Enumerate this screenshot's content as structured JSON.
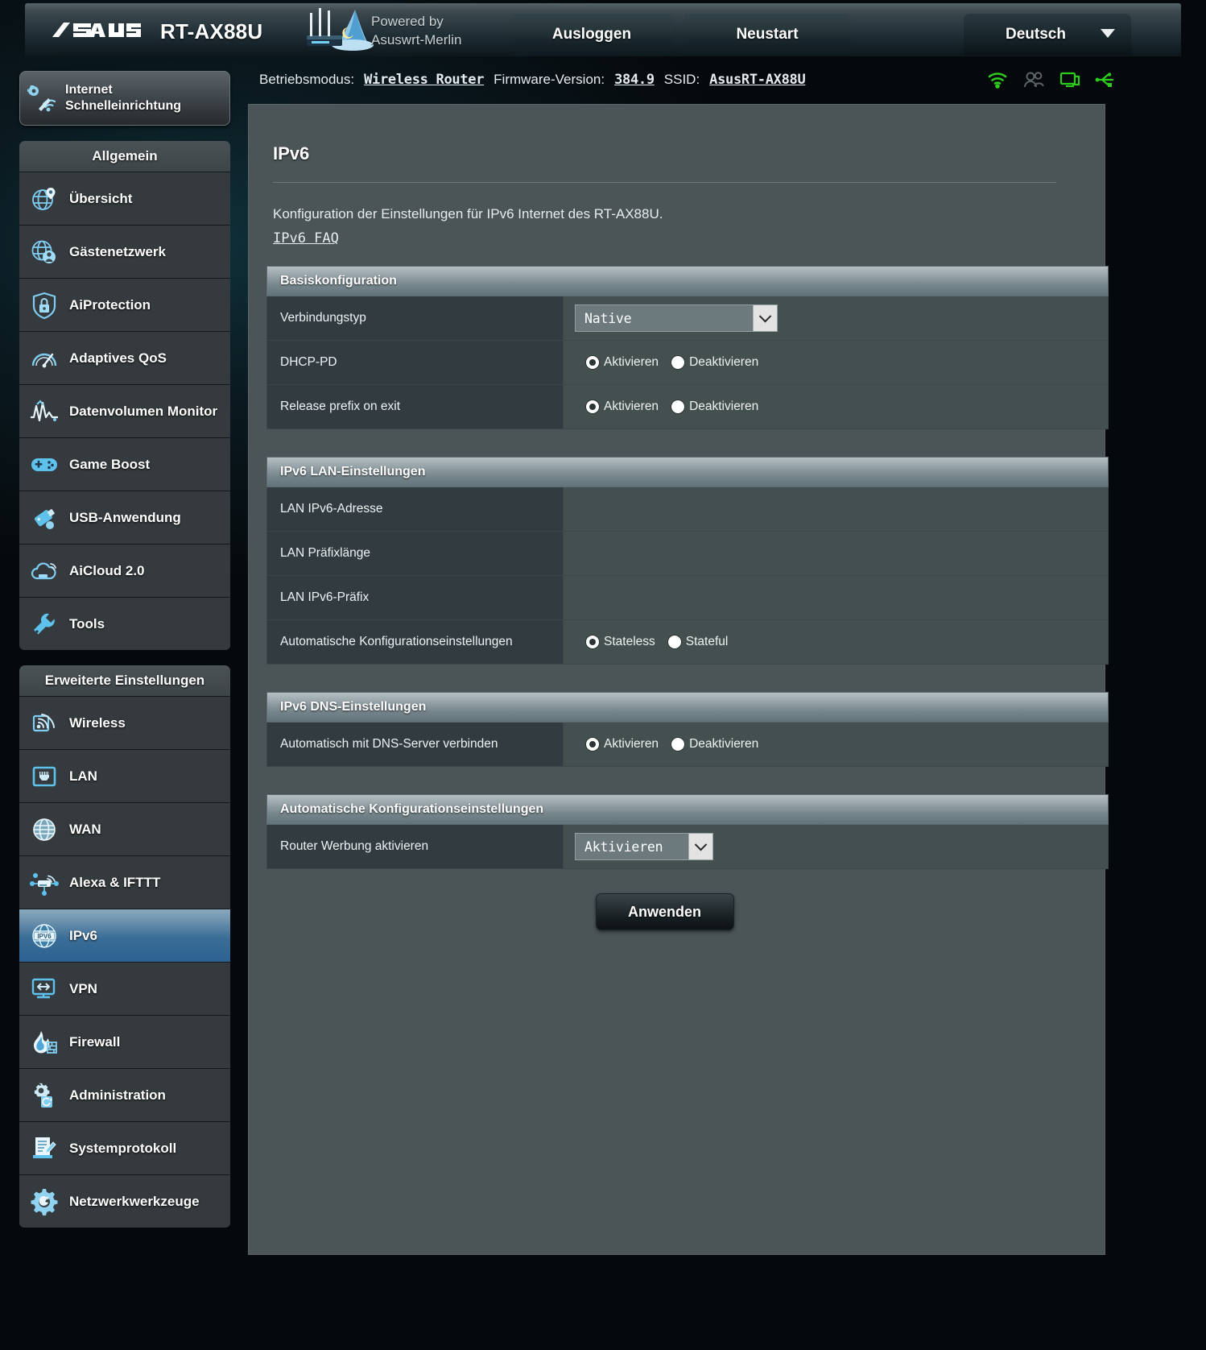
{
  "header": {
    "brand": "ASUS",
    "model": "RT-AX88U",
    "powered_by_line1": "Powered by",
    "powered_by_line2": "Asuswrt-Merlin",
    "logout_label": "Ausloggen",
    "reboot_label": "Neustart",
    "language_label": "Deutsch"
  },
  "status": {
    "mode_key": "Betriebsmodus:",
    "mode_value": "Wireless Router",
    "firmware_key": "Firmware-Version:",
    "firmware_value": "384.9",
    "ssid_key": "SSID:",
    "ssid_value": "AsusRT-AX88U",
    "icons": [
      "wifi-icon",
      "clients-icon",
      "monitor-icon",
      "usb-icon"
    ],
    "wifi_color": "#2ecc1e"
  },
  "sidebar": {
    "quick_setup": {
      "label_line1": "Internet",
      "label_line2": "Schnelleinrichtung",
      "icon": "quick-setup-icon"
    },
    "general_header": "Allgemein",
    "general_items": [
      {
        "label": "Übersicht",
        "icon": "network-map-icon"
      },
      {
        "label": "Gästenetzwerk",
        "icon": "guest-network-icon"
      },
      {
        "label": "AiProtection",
        "icon": "shield-lock-icon"
      },
      {
        "label": "Adaptives QoS",
        "icon": "gauge-icon"
      },
      {
        "label": "Datenvolumen Monitor",
        "icon": "traffic-monitor-icon"
      },
      {
        "label": "Game Boost",
        "icon": "gamepad-icon"
      },
      {
        "label": "USB-Anwendung",
        "icon": "usb-stick-icon"
      },
      {
        "label": "AiCloud 2.0",
        "icon": "cloud-icon"
      },
      {
        "label": "Tools",
        "icon": "wrench-icon"
      }
    ],
    "advanced_header": "Erweiterte Einstellungen",
    "advanced_items": [
      {
        "label": "Wireless",
        "icon": "wireless-icon",
        "active": false
      },
      {
        "label": "LAN",
        "icon": "lan-port-icon",
        "active": false
      },
      {
        "label": "WAN",
        "icon": "globe-icon",
        "active": false
      },
      {
        "label": "Alexa & IFTTT",
        "icon": "alexa-ifttt-icon",
        "active": false
      },
      {
        "label": "IPv6",
        "icon": "ipv6-globe-icon",
        "active": true
      },
      {
        "label": "VPN",
        "icon": "vpn-monitor-icon",
        "active": false
      },
      {
        "label": "Firewall",
        "icon": "firewall-flame-icon",
        "active": false
      },
      {
        "label": "Administration",
        "icon": "administration-gear-icon",
        "active": false
      },
      {
        "label": "Systemprotokoll",
        "icon": "system-log-icon",
        "active": false
      },
      {
        "label": "Netzwerkwerkzeuge",
        "icon": "network-tools-icon",
        "active": false
      }
    ]
  },
  "main": {
    "title": "IPv6",
    "description": "Konfiguration der Einstellungen für IPv6 Internet des RT-AX88U.",
    "faq_link": "IPv6 FAQ",
    "apply_label": "Anwenden",
    "sections": {
      "basic": {
        "header": "Basiskonfiguration",
        "connection_type_label": "Verbindungstyp",
        "connection_type_value": "Native",
        "dhcp_pd_label": "DHCP-PD",
        "dhcp_pd_enable": "Aktivieren",
        "dhcp_pd_disable": "Deaktivieren",
        "dhcp_pd_selected": "Aktivieren",
        "release_prefix_label": "Release prefix on exit",
        "release_prefix_enable": "Aktivieren",
        "release_prefix_disable": "Deaktivieren",
        "release_prefix_selected": "Aktivieren"
      },
      "lan": {
        "header": "IPv6 LAN-Einstellungen",
        "lan_address_label": "LAN IPv6-Adresse",
        "lan_address_value": "",
        "lan_prefix_length_label": "LAN Präfixlänge",
        "lan_prefix_length_value": "",
        "lan_prefix_label": "LAN IPv6-Präfix",
        "lan_prefix_value": "",
        "autoconfig_label": "Automatische Konfigurationseinstellungen",
        "autoconfig_stateless": "Stateless",
        "autoconfig_stateful": "Stateful",
        "autoconfig_selected": "Stateless"
      },
      "dns": {
        "header": "IPv6 DNS-Einstellungen",
        "auto_dns_label": "Automatisch mit DNS-Server verbinden",
        "auto_dns_enable": "Aktivieren",
        "auto_dns_disable": "Deaktivieren",
        "auto_dns_selected": "Aktivieren"
      },
      "autoconfig": {
        "header": "Automatische Konfigurationseinstellungen",
        "router_advertisement_label": "Router Werbung aktivieren",
        "router_advertisement_value": "Aktivieren"
      }
    }
  },
  "colors": {
    "accent_blue": "#3a6d96",
    "panel_bg": "#4b5457",
    "label_bg": "#323c40",
    "value_bg": "#44504f",
    "sidebar_item_bg": "#343a3d"
  }
}
